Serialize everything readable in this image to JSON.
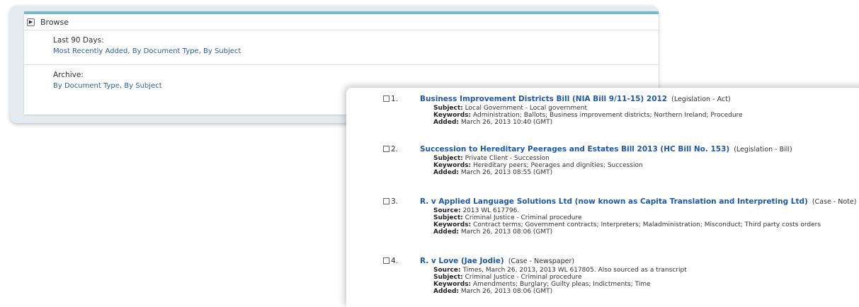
{
  "browse": {
    "header": "Browse",
    "last90": {
      "title": "Last 90 Days:",
      "links": [
        "Most Recently Added",
        "By Document Type",
        "By Subject"
      ]
    },
    "archive": {
      "title": "Archive:",
      "links": [
        "By Document Type",
        "By Subject"
      ]
    }
  },
  "results": [
    {
      "num": "1.",
      "title": "Business Improvement Districts Bill (NIA Bill 9/11-15) 2012",
      "doctype": "(Legislation - Act)",
      "fields": [
        {
          "label": "Subject:",
          "value": "Local Government - Local government"
        },
        {
          "label": "Keywords:",
          "value": "Administration; Ballots; Business improvement districts; Northern Ireland; Procedure"
        },
        {
          "label": "Added:",
          "value": "March 26, 2013 10:40 (GMT)"
        }
      ]
    },
    {
      "num": "2.",
      "title": "Succession to Hereditary Peerages and Estates Bill 2013 (HC Bill No. 153)",
      "doctype": "(Legislation - Bill)",
      "fields": [
        {
          "label": "Subject:",
          "value": "Private Client - Succession"
        },
        {
          "label": "Keywords:",
          "value": "Hereditary peers; Peerages and dignities; Succession"
        },
        {
          "label": "Added:",
          "value": "March 26, 2013 08:55 (GMT)"
        }
      ]
    },
    {
      "num": "3.",
      "title": "R. v Applied Language Solutions Ltd (now known as Capita Translation and Interpreting Ltd)",
      "doctype": "(Case - Note)",
      "fields": [
        {
          "label": "Source:",
          "value": "2013 WL 617796."
        },
        {
          "label": "Subject:",
          "value": "Criminal Justice - Criminal procedure"
        },
        {
          "label": "Keywords:",
          "value": "Contract terms; Government contracts; Interpreters; Maladministration; Misconduct; Third party costs orders"
        },
        {
          "label": "Added:",
          "value": "March 26, 2013 08:06 (GMT)"
        }
      ]
    },
    {
      "num": "4.",
      "title": "R. v Love (Jae Jodie)",
      "doctype": "(Case - Newspaper)",
      "fields": [
        {
          "label": "Source:",
          "value": "Times, March 26, 2013, 2013 WL 617805. Also sourced as a transcript"
        },
        {
          "label": "Subject:",
          "value": "Criminal Justice - Criminal procedure"
        },
        {
          "label": "Keywords:",
          "value": "Amendments; Burglary; Guilty pleas; Indictments; Time"
        },
        {
          "label": "Added:",
          "value": "March 26, 2013 08:06 (GMT)"
        }
      ]
    }
  ]
}
